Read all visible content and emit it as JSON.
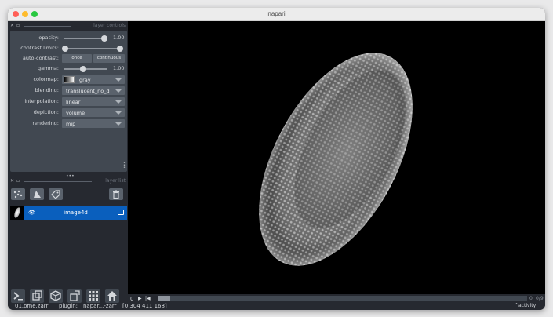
{
  "window": {
    "title": "napari"
  },
  "layer_controls": {
    "header_label": "layer controls",
    "opacity": {
      "label": "opacity:",
      "value": "1.00",
      "level": 1.0
    },
    "contrast_limits": {
      "label": "contrast limits:"
    },
    "auto_contrast": {
      "label": "auto-contrast:",
      "once": "once",
      "continuous": "continuous"
    },
    "gamma": {
      "label": "gamma:",
      "value": "1.00",
      "level": 0.5
    },
    "colormap": {
      "label": "colormap:",
      "value": "gray"
    },
    "blending": {
      "label": "blending:",
      "value": "translucent_no_depth"
    },
    "interpolation": {
      "label": "interpolation:",
      "value": "linear"
    },
    "depiction": {
      "label": "depiction:",
      "value": "volume"
    },
    "rendering": {
      "label": "rendering:",
      "value": "mip"
    }
  },
  "layer_list": {
    "header_label": "layer list",
    "layers": [
      {
        "name": "image4d",
        "visible": true,
        "selected": true
      }
    ]
  },
  "dims": {
    "current": "0",
    "index": "0",
    "max": "0/9",
    "slider_position": 0.0
  },
  "status_bar": {
    "file": "01.ome.zarr",
    "plugin_label": "plugin:",
    "plugin_value": "napar...-zarr",
    "coords": "[0 304 411 168]",
    "activity": "activity"
  },
  "colors": {
    "accent": "#0a5fbd",
    "panel": "#414851",
    "background": "#262930"
  }
}
